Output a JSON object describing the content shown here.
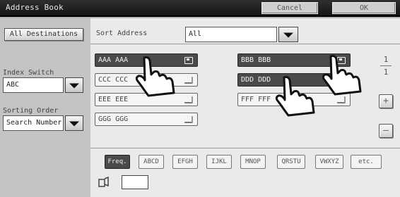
{
  "titlebar": {
    "title": "Address Book",
    "cancel_label": "Cancel",
    "ok_label": "OK"
  },
  "left": {
    "all_destinations_label": "All Destinations",
    "index_switch_label": "Index Switch",
    "index_switch_value": "ABC",
    "sorting_order_label": "Sorting Order",
    "sorting_order_value": "Search Number"
  },
  "main": {
    "sort_address_label": "Sort Address",
    "sort_address_value": "All",
    "entries": [
      {
        "name": "AAA AAA",
        "selected": true
      },
      {
        "name": "BBB BBB",
        "selected": true
      },
      {
        "name": "CCC CCC",
        "selected": false
      },
      {
        "name": "DDD DDD",
        "selected": true
      },
      {
        "name": "EEE EEE",
        "selected": false
      },
      {
        "name": "FFF FFF",
        "selected": false
      },
      {
        "name": "GGG GGG",
        "selected": false
      }
    ],
    "page_current": "1",
    "page_total": "1",
    "tabs": [
      "Freq.",
      "ABCD",
      "EFGH",
      "IJKL",
      "MNOP",
      "QRSTU",
      "VWXYZ",
      "etc."
    ],
    "active_tab": "Freq."
  },
  "colors": {
    "selected_entry": "#4a4a4a",
    "titlebar": "#1e1e1e"
  },
  "icons": [
    "hand-pointer-icon",
    "mail-icon",
    "plus-icon",
    "minus-icon",
    "address-icon"
  ]
}
